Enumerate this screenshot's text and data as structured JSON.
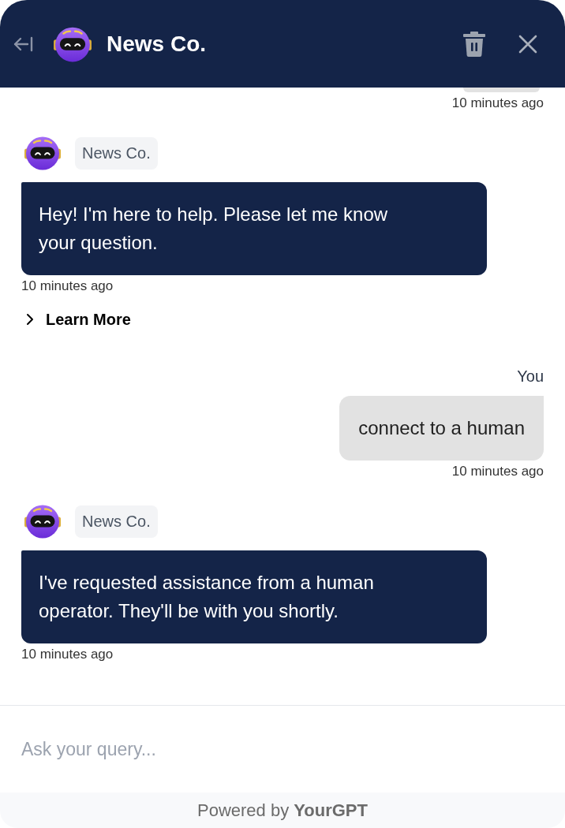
{
  "header": {
    "title": "News Co."
  },
  "messages": [
    {
      "kind": "user",
      "clipped": true,
      "timestamp": "10 minutes ago"
    },
    {
      "kind": "bot",
      "clipped": false,
      "sender": "News Co.",
      "text": "Hey! I'm here to help. Please let me know your question.",
      "timestamp": "10 minutes ago",
      "link": {
        "label": "Learn More",
        "expanded": false
      }
    },
    {
      "kind": "user",
      "clipped": false,
      "sender": "You",
      "text": "connect to a human",
      "timestamp": "10 minutes ago"
    },
    {
      "kind": "bot",
      "clipped": false,
      "sender": "News Co.",
      "text": "I've requested assistance from a human operator. They'll be with you shortly.",
      "timestamp": "10 minutes ago"
    }
  ],
  "composer": {
    "placeholder": "Ask your query..."
  },
  "footer": {
    "text": "Powered by **YourGPT**"
  }
}
